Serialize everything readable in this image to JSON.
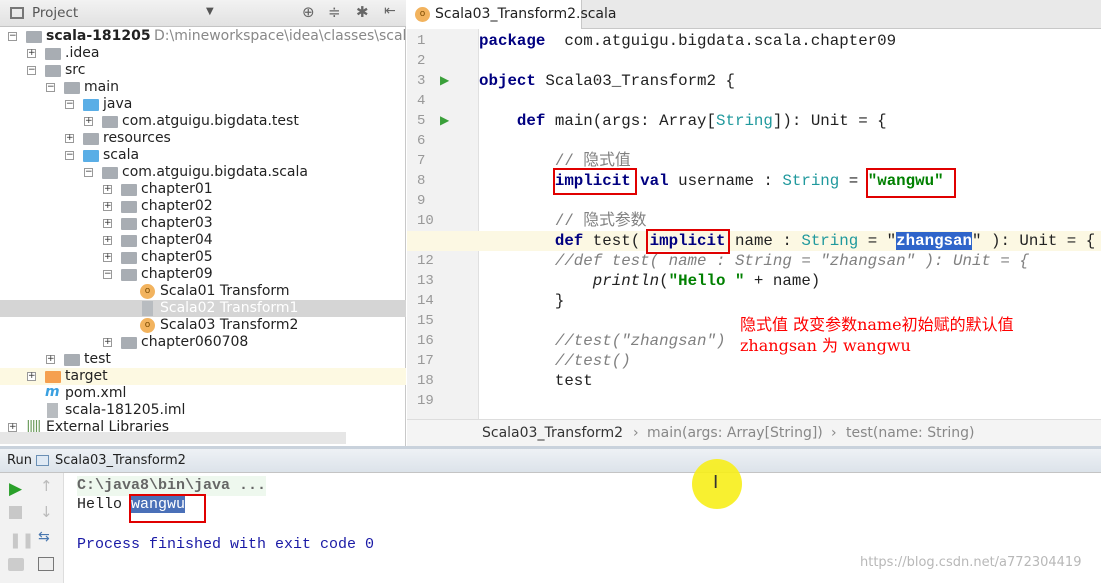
{
  "project": {
    "title": "Project",
    "tree": [
      {
        "label": "scala-181205",
        "extra": "D:\\mineworkspace\\idea\\classes\\scal",
        "depth": 0,
        "exp": "-",
        "icon": "module",
        "bold": true
      },
      {
        "label": ".idea",
        "depth": 1,
        "exp": "+",
        "icon": "folder"
      },
      {
        "label": "src",
        "depth": 1,
        "exp": "-",
        "icon": "folder"
      },
      {
        "label": "main",
        "depth": 2,
        "exp": "-",
        "icon": "folder"
      },
      {
        "label": "java",
        "depth": 3,
        "exp": "-",
        "icon": "folder-blue"
      },
      {
        "label": "com.atguigu.bigdata.test",
        "depth": 4,
        "exp": "+",
        "icon": "package"
      },
      {
        "label": "resources",
        "depth": 3,
        "exp": "+",
        "icon": "folder"
      },
      {
        "label": "scala",
        "depth": 3,
        "exp": "-",
        "icon": "folder-blue"
      },
      {
        "label": "com.atguigu.bigdata.scala",
        "depth": 4,
        "exp": "-",
        "icon": "package"
      },
      {
        "label": "chapter01",
        "depth": 5,
        "exp": "+",
        "icon": "package"
      },
      {
        "label": "chapter02",
        "depth": 5,
        "exp": "+",
        "icon": "package"
      },
      {
        "label": "chapter03",
        "depth": 5,
        "exp": "+",
        "icon": "package"
      },
      {
        "label": "chapter04",
        "depth": 5,
        "exp": "+",
        "icon": "package"
      },
      {
        "label": "chapter05",
        "depth": 5,
        "exp": "+",
        "icon": "package"
      },
      {
        "label": "chapter09",
        "depth": 5,
        "exp": "-",
        "icon": "package"
      },
      {
        "label": "Scala01  Transform",
        "depth": 6,
        "icon": "object"
      },
      {
        "label": "Scala02  Transform1",
        "depth": 6,
        "icon": "file",
        "selected": true
      },
      {
        "label": "Scala03  Transform2",
        "depth": 6,
        "icon": "object"
      },
      {
        "label": "chapter060708",
        "depth": 5,
        "exp": "+",
        "icon": "package"
      },
      {
        "label": "test",
        "depth": 2,
        "exp": "+",
        "icon": "folder"
      },
      {
        "label": "target",
        "depth": 1,
        "exp": "+",
        "icon": "folder-orange",
        "highlight": true
      },
      {
        "label": "pom.xml",
        "depth": 1,
        "icon": "maven"
      },
      {
        "label": "scala-181205.iml",
        "depth": 1,
        "icon": "file"
      },
      {
        "label": "External Libraries",
        "depth": 0,
        "exp": "+",
        "icon": "libraries"
      }
    ]
  },
  "editor": {
    "tab": "Scala03_Transform2.scala",
    "lines": [
      [
        [
          "kw",
          "package"
        ],
        [
          "",
          "  com.atguigu.bigdata.scala.chapter09"
        ]
      ],
      [],
      [
        [
          "kw",
          "object"
        ],
        [
          "",
          " Scala03_Transform2 {"
        ]
      ],
      [],
      [
        [
          "",
          "    "
        ],
        [
          "kw",
          "def"
        ],
        [
          "",
          " main(args: Array["
        ],
        [
          "ty",
          "String"
        ],
        [
          "",
          "]): Unit = {"
        ]
      ],
      [],
      [
        [
          "",
          "        "
        ],
        [
          "cm",
          "// 隐式值"
        ]
      ],
      [
        [
          "",
          "        "
        ],
        [
          "kw",
          "implicit"
        ],
        [
          "",
          " "
        ],
        [
          "kw",
          "val"
        ],
        [
          "",
          " username : "
        ],
        [
          "ty",
          "String"
        ],
        [
          "",
          " = "
        ],
        [
          "str",
          "\"wangwu\""
        ]
      ],
      [],
      [
        [
          "",
          "        "
        ],
        [
          "cm",
          "// 隐式参数"
        ]
      ],
      [
        [
          "",
          "        "
        ],
        [
          "kw",
          "def"
        ],
        [
          "",
          " test( "
        ],
        [
          "kw",
          "implicit"
        ],
        [
          "",
          " name : "
        ],
        [
          "ty",
          "String"
        ],
        [
          "",
          " = \""
        ],
        [
          "kw sel",
          "zhangsan"
        ],
        [
          "",
          "\" ): Unit = {"
        ]
      ],
      [
        [
          "",
          "        "
        ],
        [
          "cmi",
          "//def test( name : String = \"zhangsan\" ): Unit = {"
        ]
      ],
      [
        [
          "",
          "            "
        ],
        [
          "fn",
          "println"
        ],
        [
          "",
          "("
        ],
        [
          "str",
          "\"Hello \""
        ],
        [
          "",
          " + name)"
        ]
      ],
      [
        [
          "",
          "        }"
        ]
      ],
      [],
      [
        [
          "",
          "        "
        ],
        [
          "cmi",
          "//test(\"zhangsan\")"
        ]
      ],
      [
        [
          "",
          "        "
        ],
        [
          "cmi",
          "//test()"
        ]
      ],
      [
        [
          "",
          "        test"
        ]
      ],
      []
    ],
    "annotation": [
      "隐式值 改变参数name初始赋的默认值",
      "zhangsan 为 wangwu"
    ],
    "breadcrumbs": [
      "Scala03_Transform2",
      "main(args: Array[String])",
      "test(name: String)"
    ]
  },
  "run": {
    "label": "Run",
    "config": "Scala03_Transform2",
    "console": {
      "cmd": "C:\\java8\\bin\\java ...",
      "hello": "Hello ",
      "value": "wangwu",
      "exit": "Process finished with exit code 0"
    }
  },
  "watermark": "https://blog.csdn.net/a772304419"
}
